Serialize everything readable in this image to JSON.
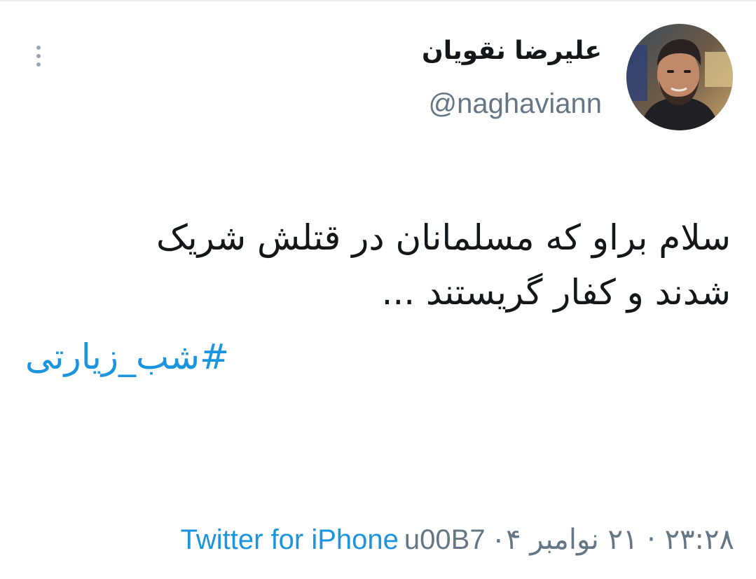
{
  "tweet": {
    "author": {
      "display_name": "علیرضا نقویان",
      "handle": "@naghaviann",
      "avatar_icon": "user-photo"
    },
    "menu_icon": "more-vertical-icon",
    "text_lines": [
      "سلام براو که مسلمانان در قتلش شریک",
      "شدند و کفار گریستند ..."
    ],
    "hashtag": "#شب_زیارتی",
    "meta": {
      "time_date": "۲۳:۲۸ · ۲۱ نوامبر ۰۴",
      "separator": "u00B7",
      "source": "Twitter for iPhone"
    }
  },
  "colors": {
    "text": "#14171a",
    "secondary": "#657786",
    "link": "#1b95e0",
    "background": "#ffffff"
  }
}
